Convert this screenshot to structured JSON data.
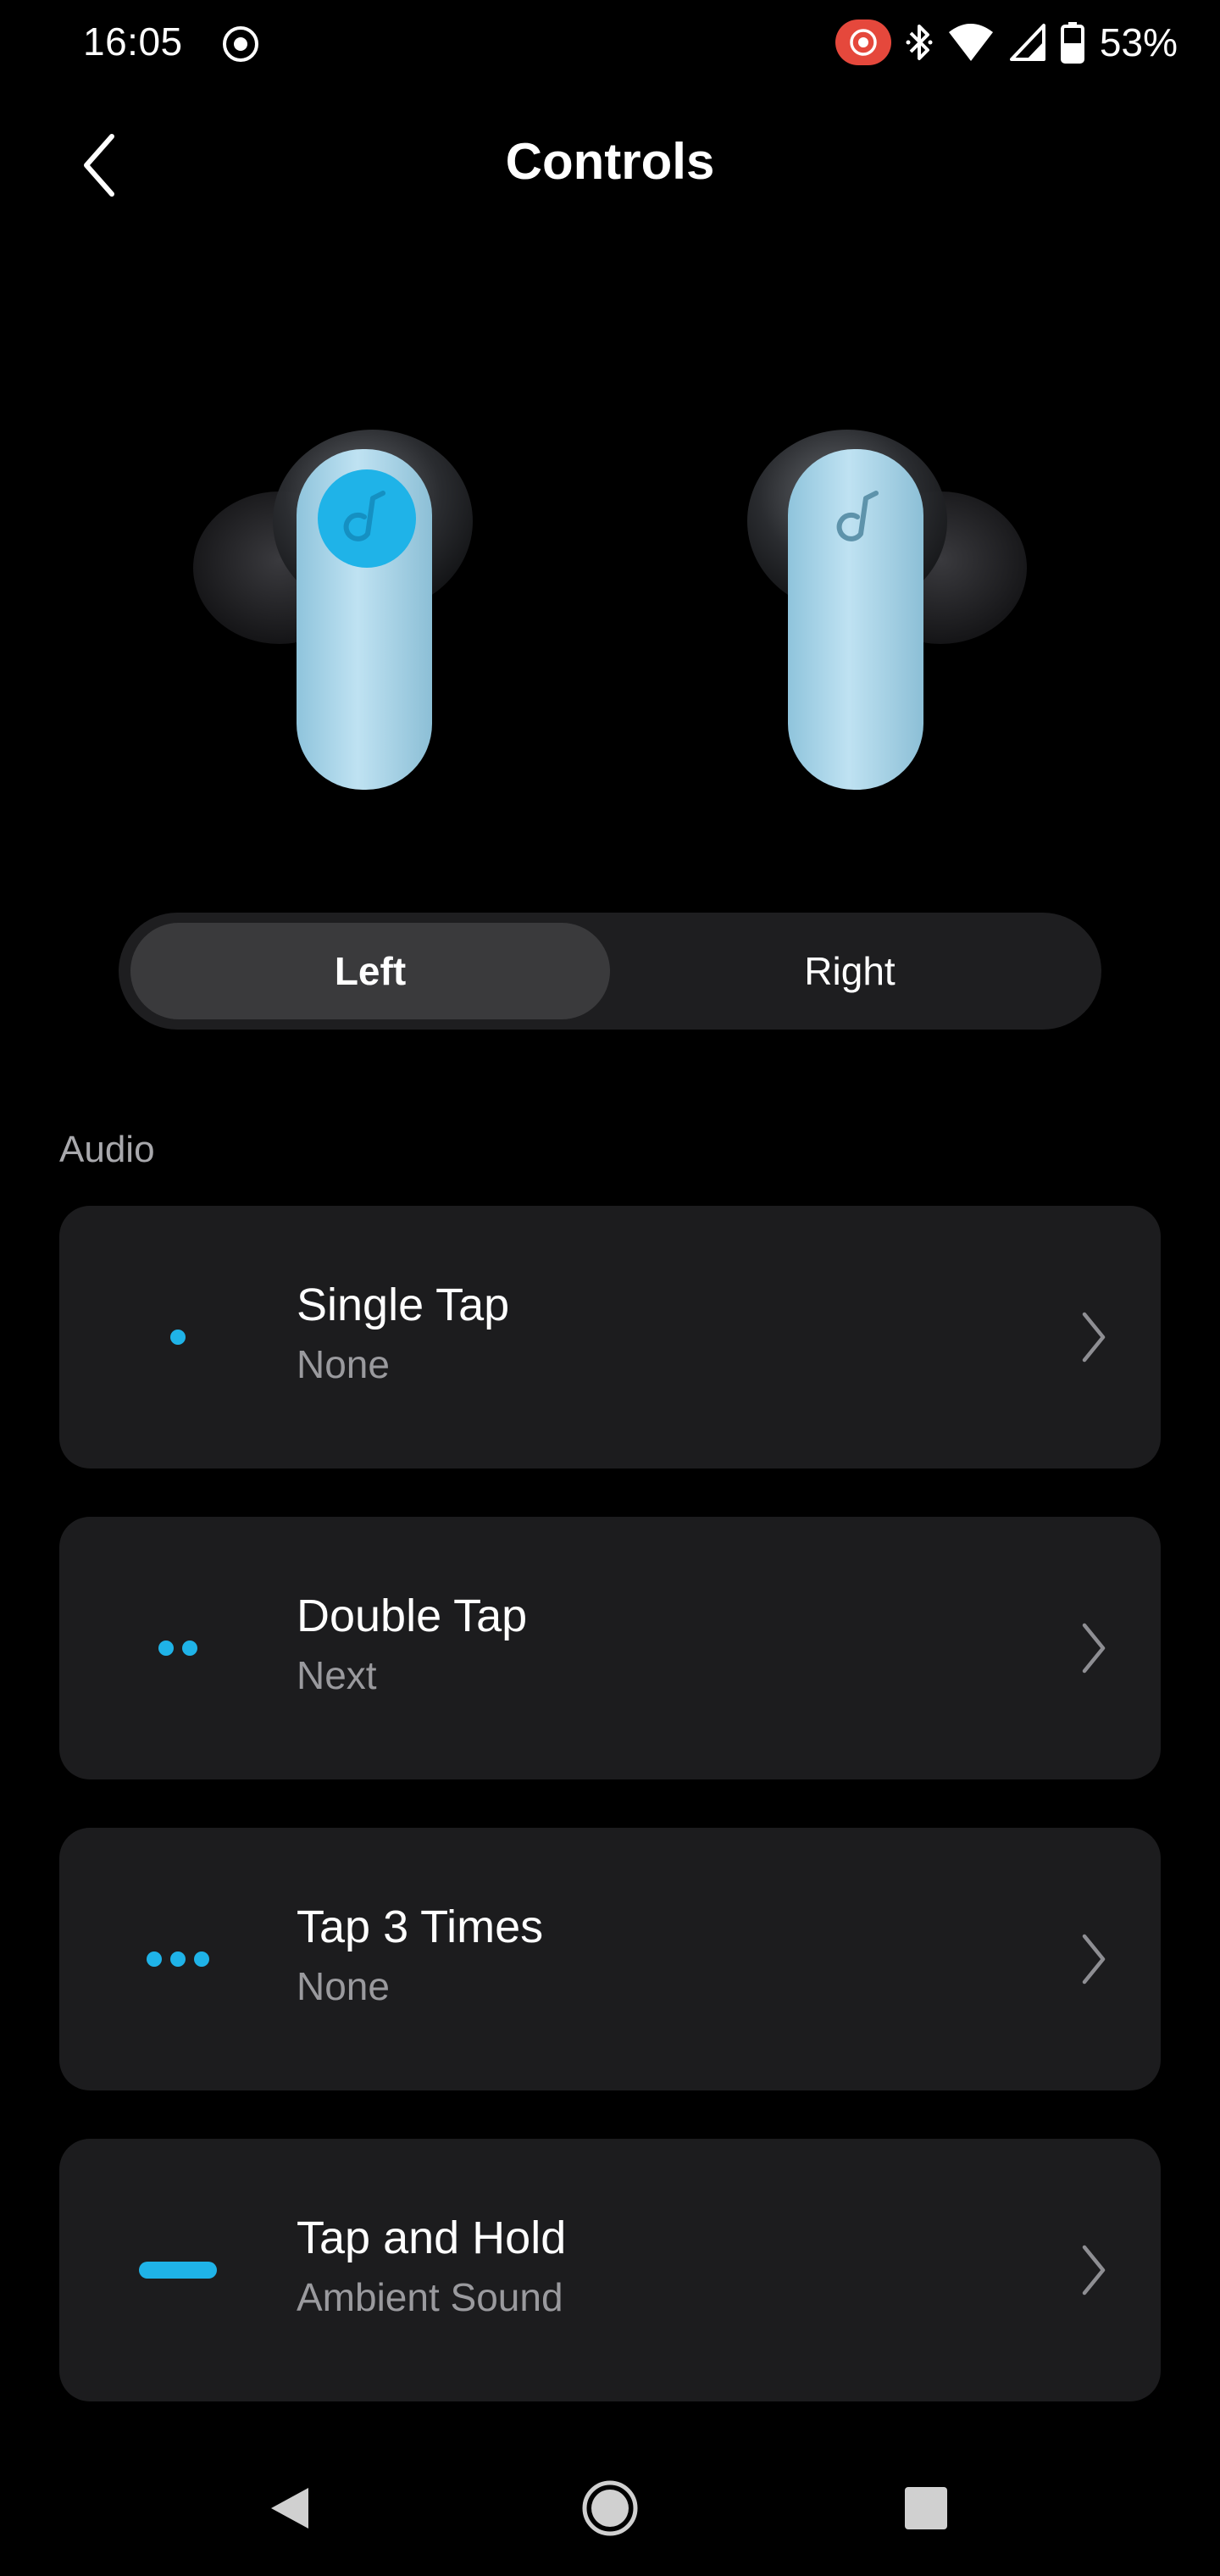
{
  "status_bar": {
    "time": "16:05",
    "battery_percent": "53%",
    "icons": [
      "screen-record-icon",
      "cast-icon",
      "bluetooth-icon",
      "wifi-icon",
      "signal-icon",
      "battery-icon"
    ]
  },
  "header": {
    "title": "Controls",
    "back_icon": "chevron-left-icon"
  },
  "side_toggle": {
    "options": [
      "Left",
      "Right"
    ],
    "selected": "Left"
  },
  "section": {
    "label": "Audio"
  },
  "controls": [
    {
      "title": "Single Tap",
      "value": "None",
      "icon": "single-dot-icon"
    },
    {
      "title": "Double Tap",
      "value": "Next",
      "icon": "double-dot-icon"
    },
    {
      "title": "Tap 3 Times",
      "value": "None",
      "icon": "triple-dot-icon"
    },
    {
      "title": "Tap and Hold",
      "value": "Ambient Sound",
      "icon": "hold-bar-icon"
    }
  ],
  "colors": {
    "accent": "#1fb3e8",
    "card_bg": "#1c1c1e",
    "toggle_bg": "#1e1e20",
    "toggle_selected": "#3a3a3c",
    "cast_badge": "#e5483c"
  },
  "nav_bar": {
    "icons": [
      "nav-back-icon",
      "nav-home-icon",
      "nav-recents-icon"
    ]
  }
}
